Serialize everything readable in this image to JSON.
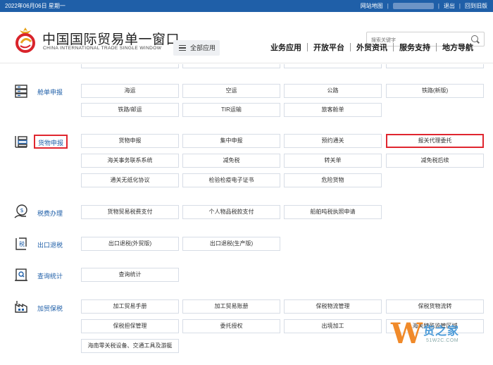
{
  "topbar": {
    "date": "2022年06月06日 星期一",
    "links": [
      "网站地图",
      "退出",
      "回到旧版"
    ]
  },
  "header": {
    "brand_cn": "中国国际贸易单一窗口",
    "brand_en": "CHINA INTERNATIONAL TRADE SINGLE WINDOW",
    "all_apps": "全部应用",
    "search_placeholder": "搜索关键字",
    "nav": [
      "业务应用",
      "开放平台",
      "外贸资讯",
      "服务支持",
      "地方导航"
    ]
  },
  "sections": [
    {
      "label": "舱单申报",
      "icon": "manifest-icon",
      "buttons": [
        "海运",
        "空运",
        "公路",
        "铁路(新版)",
        "铁路/邮运",
        "TIR运输",
        "旅客舱单"
      ]
    },
    {
      "label": "货物申报",
      "icon": "cargo-declaration-icon",
      "buttons": [
        "货物申报",
        "集中申报",
        "预约通关",
        "报关代理委托",
        "海关事务联系系统",
        "减免税",
        "转关单",
        "减免税后续",
        "通关无纸化协议",
        "检验检疫电子证书",
        "危险货物"
      ]
    },
    {
      "label": "税费办理",
      "icon": "tax-payment-icon",
      "buttons": [
        "货物贸易税费支付",
        "个人物品税款支付",
        "船舶吨税执照申请"
      ]
    },
    {
      "label": "出口退税",
      "icon": "export-tax-rebate-icon",
      "buttons": [
        "出口退税(外贸版)",
        "出口退税(生产版)"
      ]
    },
    {
      "label": "查询统计",
      "icon": "query-statistics-icon",
      "buttons": [
        "查询统计"
      ]
    },
    {
      "label": "加贸保税",
      "icon": "processing-trade-icon",
      "buttons": [
        "加工贸易手册",
        "加工贸易账册",
        "保税物流管理",
        "保税货物流转",
        "保税担保管理",
        "委托授权",
        "出境加工",
        "海关特殊监管区域",
        "海南零关税设备、交通工具及游艇"
      ]
    }
  ],
  "watermark": {
    "cn": "货之家",
    "en": "51W2C.COM"
  },
  "colors": {
    "topbar": "#1f5fa8",
    "label": "#1f5fa8",
    "highlight": "#e0262f"
  }
}
